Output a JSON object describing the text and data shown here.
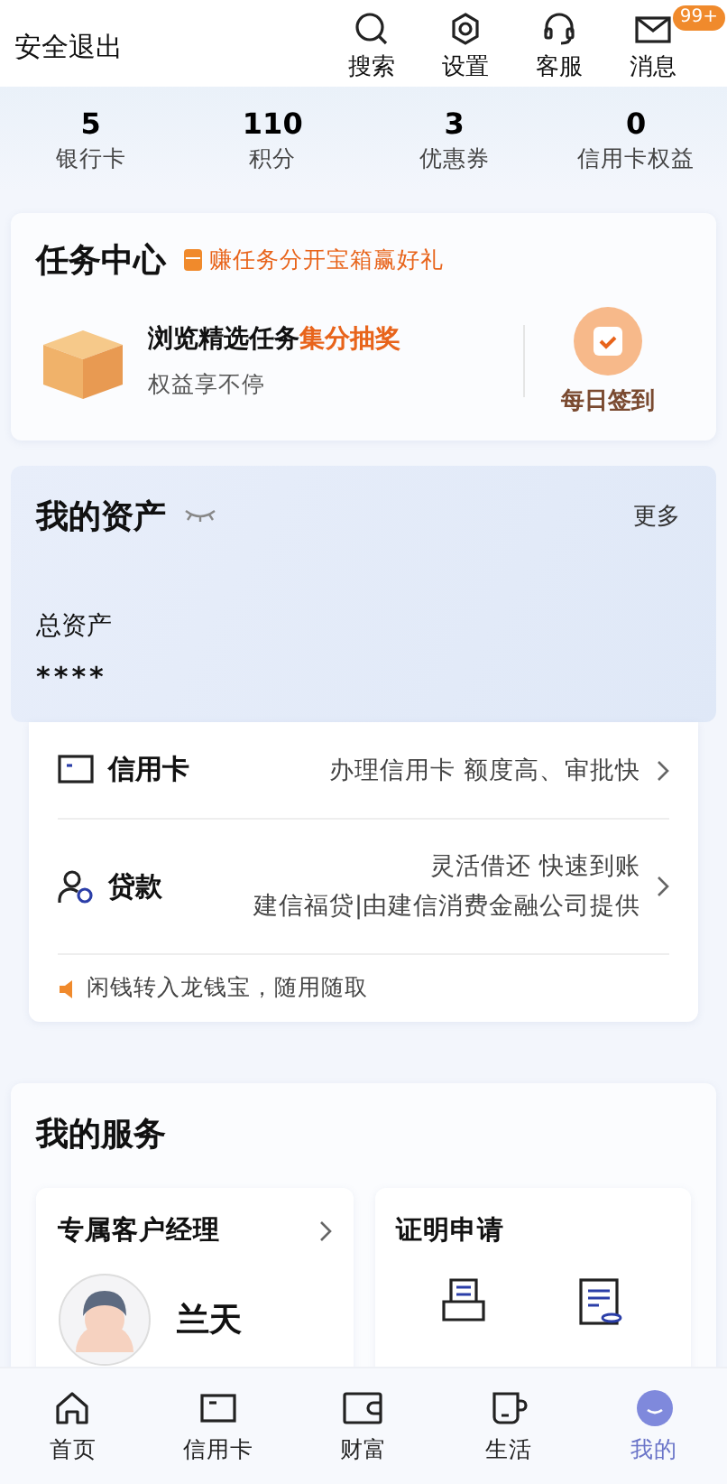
{
  "header": {
    "logout": "安全退出",
    "actions": [
      {
        "kind": "search",
        "label": "搜索"
      },
      {
        "kind": "settings",
        "label": "设置"
      },
      {
        "kind": "service",
        "label": "客服"
      },
      {
        "kind": "message",
        "label": "消息",
        "badge": "99+"
      }
    ]
  },
  "stats": [
    {
      "value": "5",
      "label": "银行卡"
    },
    {
      "value": "110",
      "label": "积分"
    },
    {
      "value": "3",
      "label": "优惠券"
    },
    {
      "value": "0",
      "label": "信用卡权益"
    }
  ],
  "task_center": {
    "title": "任务中心",
    "promo": "赚任务分开宝箱赢好礼",
    "task_title": "浏览精选任务**集分抽奖**",
    "task_subtitle": "权益享不停",
    "checkin": "每日签到"
  },
  "assets": {
    "title": "我的资产",
    "more": "更多",
    "total_label": "总资产",
    "total_value": "****",
    "products": [
      {
        "kind": "card",
        "name": "信用卡",
        "lines": [
          "办理信用卡 额度高、审批快"
        ]
      },
      {
        "kind": "loan",
        "name": "贷款",
        "lines": [
          "灵活借还 快速到账",
          "建信福贷|由建信消费金融公司提供"
        ]
      }
    ],
    "notice": "闲钱转入龙钱宝，随用随取"
  },
  "services": {
    "title": "我的服务",
    "manager": {
      "title": "专属客户经理",
      "name": "兰天"
    },
    "certificate": {
      "title": "证明申请"
    }
  },
  "nav": [
    {
      "kind": "home",
      "label": "首页",
      "selected": false
    },
    {
      "kind": "card",
      "label": "信用卡",
      "selected": false
    },
    {
      "kind": "wallet",
      "label": "财富",
      "selected": false
    },
    {
      "kind": "cup",
      "label": "生活",
      "selected": false
    },
    {
      "kind": "me",
      "label": "我的",
      "selected": true
    }
  ]
}
